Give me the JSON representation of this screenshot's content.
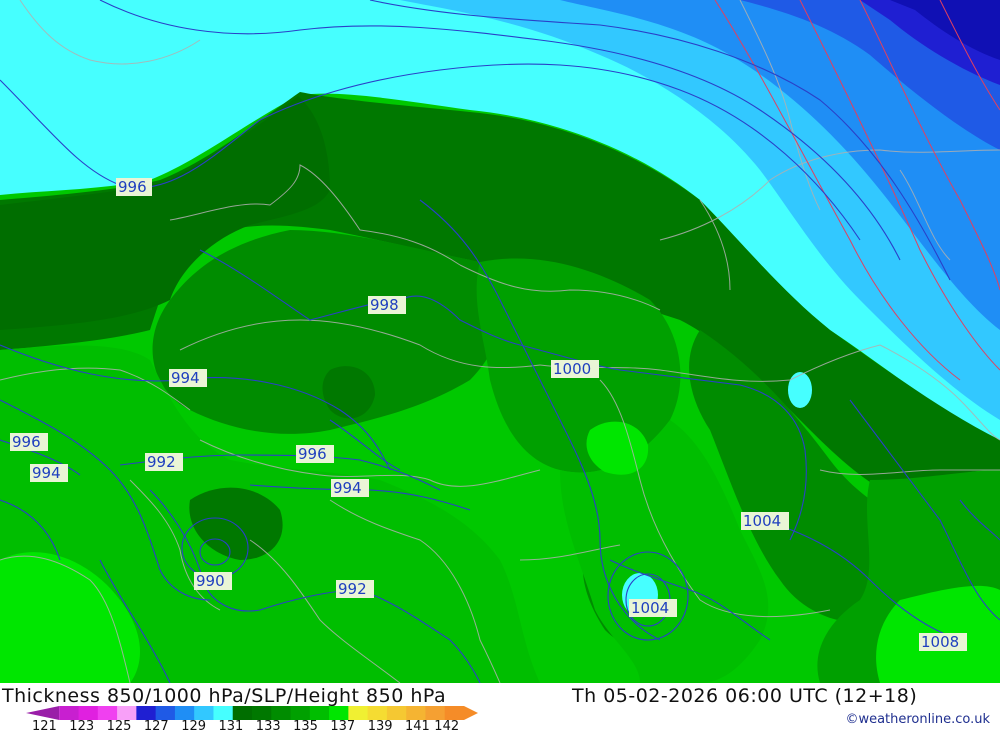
{
  "title": "Thickness 850/1000 hPa/SLP/Height 850 hPa",
  "valid_time": "Th 05-02-2026 06:00 UTC (12+18)",
  "credit": "©weatheronline.co.uk",
  "legend": {
    "labels": [
      "121",
      "123",
      "125",
      "127",
      "129",
      "131",
      "133",
      "135",
      "137",
      "139",
      "141",
      "142"
    ],
    "colors": [
      "#9a1fa8",
      "#c81fd0",
      "#e020e0",
      "#f040f0",
      "#f8a0f8",
      "#1f1fd2",
      "#1f5ae6",
      "#1f8ef5",
      "#32c8ff",
      "#46ffff",
      "#006e00",
      "#007800",
      "#008c00",
      "#00a000",
      "#00be00",
      "#00e600",
      "#f0f032",
      "#f5dc32",
      "#f5c832",
      "#f5b432",
      "#f5a032",
      "#f58c28"
    ]
  },
  "isobar_labels": [
    "996",
    "998",
    "994",
    "996",
    "994",
    "992",
    "996",
    "994",
    "990",
    "992",
    "1000",
    "1004",
    "1004",
    "1008"
  ]
}
